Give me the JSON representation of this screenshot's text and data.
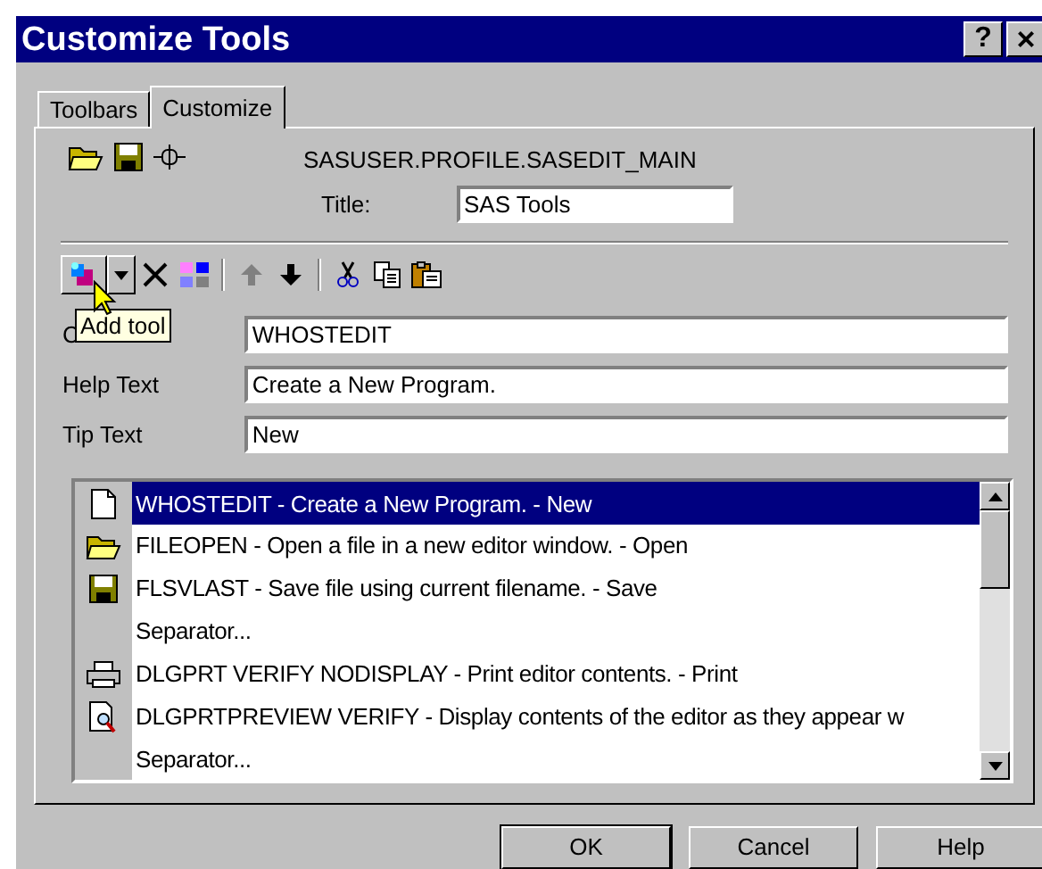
{
  "window": {
    "title": "Customize Tools",
    "help_button": "?",
    "close_button": "×"
  },
  "tabs": [
    {
      "label": "Toolbars",
      "selected": false
    },
    {
      "label": "Customize",
      "selected": true
    }
  ],
  "profile": {
    "path": "SASUSER.PROFILE.SASEDIT_MAIN",
    "title_label": "Title:",
    "title_value": "SAS Tools"
  },
  "toolbar": [
    {
      "kind": "add"
    },
    {
      "kind": "dropdown"
    },
    {
      "kind": "delete"
    },
    {
      "kind": "properties"
    },
    {
      "kind": "separator"
    },
    {
      "kind": "up",
      "disabled": true
    },
    {
      "kind": "down"
    },
    {
      "kind": "separator"
    },
    {
      "kind": "cut"
    },
    {
      "kind": "copy"
    },
    {
      "kind": "paste"
    }
  ],
  "tooltip": "Add tool",
  "fields": [
    {
      "label": "C",
      "value": "WHOSTEDIT"
    },
    {
      "label": "Help Text",
      "value": "Create a New Program."
    },
    {
      "label": "Tip Text",
      "value": "New"
    }
  ],
  "tools": [
    {
      "kind": "new",
      "text": "WHOSTEDIT - Create a New Program. - New",
      "selected": true
    },
    {
      "kind": "open",
      "text": "FILEOPEN - Open a file in a new editor window. - Open",
      "selected": false
    },
    {
      "kind": "save",
      "text": "FLSVLAST - Save file using current filename. - Save",
      "selected": false
    },
    {
      "kind": "separator",
      "text": "Separator...",
      "selected": false
    },
    {
      "kind": "print",
      "text": "DLGPRT VERIFY NODISPLAY - Print editor contents. - Print",
      "selected": false
    },
    {
      "kind": "preview",
      "text": "DLGPRTPREVIEW VERIFY - Display contents of the editor as they appear w",
      "selected": false
    },
    {
      "kind": "separator",
      "text": "Separator...",
      "selected": false
    }
  ],
  "buttons": [
    "OK",
    "Cancel",
    "Help"
  ]
}
